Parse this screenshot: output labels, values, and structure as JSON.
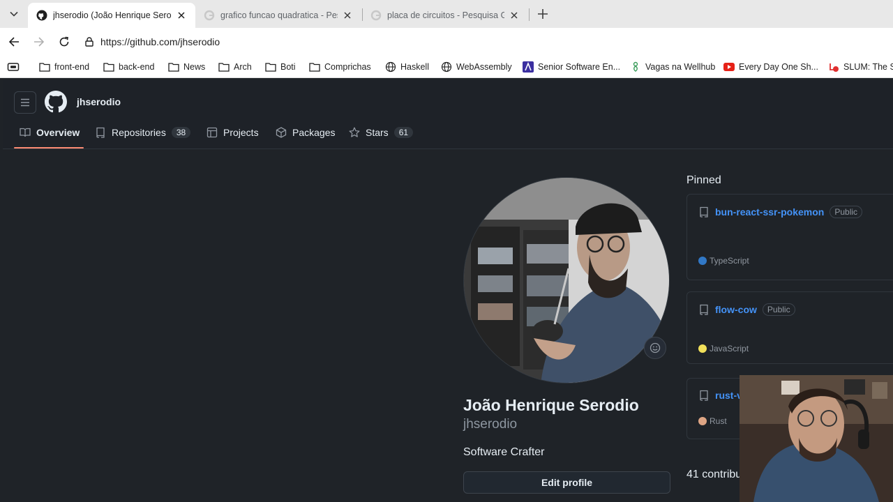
{
  "browser": {
    "tabs": [
      {
        "title": "jhserodio (João Henrique Serodio)",
        "active": true,
        "favicon": "github-icon"
      },
      {
        "title": "grafico funcao quadratica - Pesquisa Google",
        "active": false,
        "favicon": "google-icon"
      },
      {
        "title": "placa de circuitos - Pesquisa Google",
        "active": false,
        "favicon": "google-icon"
      }
    ],
    "url": "https://github.com/jhserodio",
    "bookmarks": [
      {
        "label": "front-end",
        "icon": "folder-icon"
      },
      {
        "label": "back-end",
        "icon": "folder-icon"
      },
      {
        "label": "News",
        "icon": "folder-icon"
      },
      {
        "label": "Arch",
        "icon": "folder-icon"
      },
      {
        "label": "Boti",
        "icon": "folder-icon"
      },
      {
        "label": "Comprichas",
        "icon": "folder-icon"
      },
      {
        "label": "Haskell",
        "icon": "globe-icon"
      },
      {
        "label": "WebAssembly",
        "icon": "globe-icon"
      },
      {
        "label": "Senior Software En...",
        "icon": "linear-icon"
      },
      {
        "label": "Vagas na Wellhub",
        "icon": "wellhub-icon"
      },
      {
        "label": "Every Day One Sh...",
        "icon": "youtube-icon"
      },
      {
        "label": "SLUM: The Sl",
        "icon": "slum-icon"
      }
    ]
  },
  "github": {
    "username": "jhserodio",
    "nav": [
      {
        "label": "Overview",
        "count": null,
        "icon": "book-icon"
      },
      {
        "label": "Repositories",
        "count": "38",
        "icon": "repo-icon"
      },
      {
        "label": "Projects",
        "count": null,
        "icon": "table-icon"
      },
      {
        "label": "Packages",
        "count": null,
        "icon": "package-icon"
      },
      {
        "label": "Stars",
        "count": "61",
        "icon": "star-icon"
      }
    ],
    "profile": {
      "full_name": "João Henrique Serodio",
      "login": "jhserodio",
      "bio": "Software Crafter",
      "edit_label": "Edit profile"
    },
    "pinned": {
      "title": "Pinned",
      "repos": [
        {
          "name": "bun-react-ssr-pokemon",
          "visibility": "Public",
          "language": "TypeScript",
          "lang_color": "#3178c6"
        },
        {
          "name": "flow-cow",
          "visibility": "Public",
          "language": "JavaScript",
          "lang_color": "#f1e05a"
        },
        {
          "name": "rust-v",
          "visibility": "",
          "language": "Rust",
          "lang_color": "#dea584"
        }
      ]
    },
    "contributions_label": "41 contribu"
  },
  "colors": {
    "accent_link": "#4493f8",
    "selected_tab_underline": "#fd8c73",
    "page_bg": "#1f2328"
  }
}
